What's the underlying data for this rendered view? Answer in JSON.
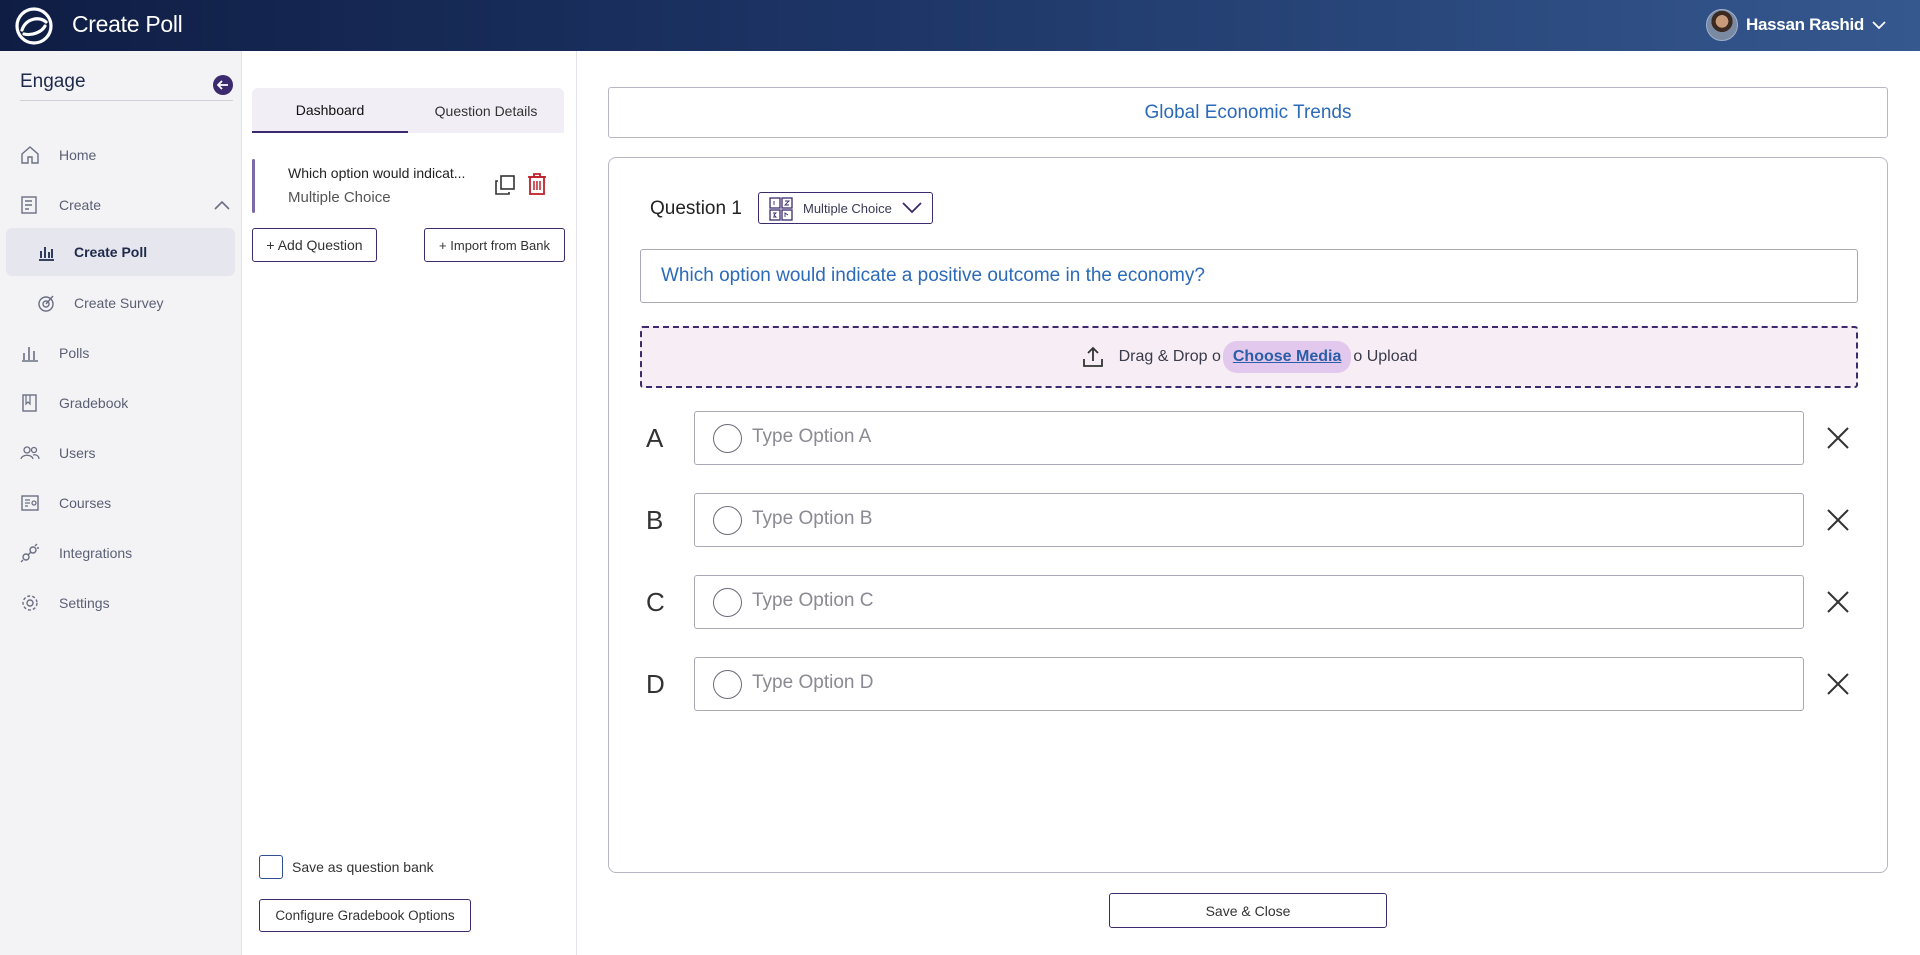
{
  "topbar": {
    "app_title": "Create Poll",
    "user_name": "Hassan Rashid"
  },
  "sidebar": {
    "title": "Engage",
    "items": [
      {
        "label": "Home",
        "icon": "home-icon"
      },
      {
        "label": "Create",
        "icon": "create-icon",
        "expanded": true
      },
      {
        "label": "Create Poll",
        "icon": "poll-chart-icon",
        "active": true
      },
      {
        "label": "Create Survey",
        "icon": "survey-icon"
      },
      {
        "label": "Polls",
        "icon": "bar-chart-icon"
      },
      {
        "label": "Gradebook",
        "icon": "book-icon"
      },
      {
        "label": "Users",
        "icon": "users-icon"
      },
      {
        "label": "Courses",
        "icon": "courses-icon"
      },
      {
        "label": "Integrations",
        "icon": "integrations-icon"
      },
      {
        "label": "Settings",
        "icon": "gear-icon"
      }
    ]
  },
  "middle": {
    "tabs": [
      {
        "label": "Dashboard",
        "active": true
      },
      {
        "label": "Question Details",
        "active": false
      }
    ],
    "question_card": {
      "title": "Which option would indicat...",
      "type": "Multiple Choice"
    },
    "add_question_label": "+ Add Question",
    "import_label": "+ Import from Bank",
    "save_bank_label": "Save as question bank",
    "configure_label": "Configure Gradebook Options"
  },
  "main": {
    "poll_title": "Global Economic Trends",
    "question_label": "Question 1",
    "question_type": "Multiple Choice",
    "question_text": "Which option would indicate a positive outcome in the economy?",
    "upload": {
      "prefix": "Drag & Drop o",
      "link": "Choose Media",
      "suffix": "o Upload"
    },
    "options": [
      {
        "letter": "A",
        "placeholder": "Type Option A"
      },
      {
        "letter": "B",
        "placeholder": "Type Option B"
      },
      {
        "letter": "C",
        "placeholder": "Type Option C"
      },
      {
        "letter": "D",
        "placeholder": "Type Option D"
      }
    ],
    "save_close_label": "Save & Close"
  },
  "colors": {
    "brand_dark": "#0f1d44",
    "accent_purple": "#3c2a6e",
    "link_blue": "#2b6ab8",
    "delete_red": "#c0202a"
  }
}
